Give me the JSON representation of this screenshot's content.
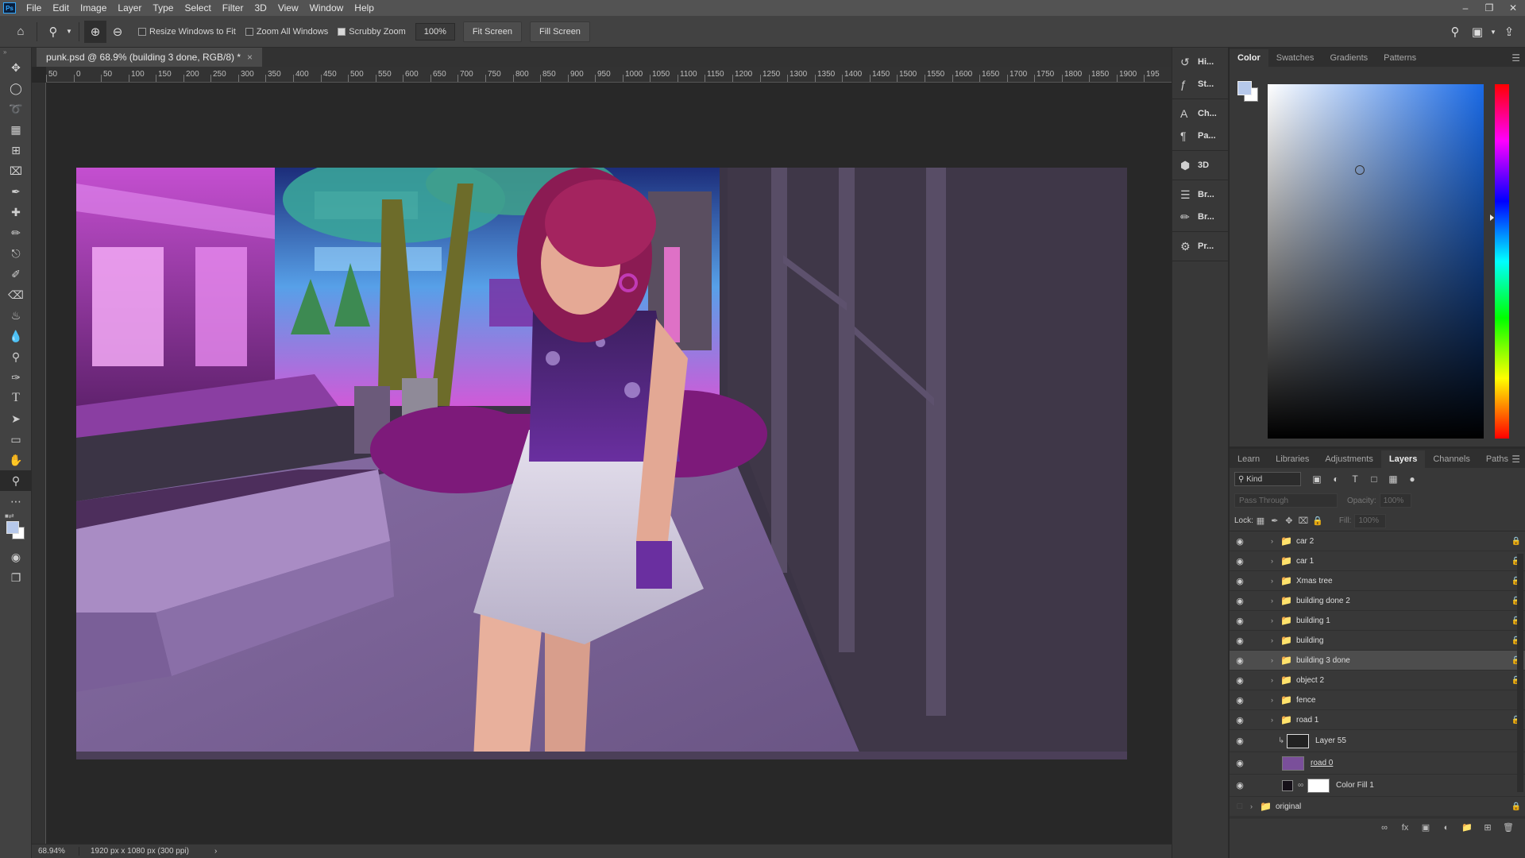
{
  "menu": {
    "items": [
      "File",
      "Edit",
      "Image",
      "Layer",
      "Type",
      "Select",
      "Filter",
      "3D",
      "View",
      "Window",
      "Help"
    ]
  },
  "options": {
    "resize_windows": "Resize Windows to Fit",
    "zoom_all": "Zoom All Windows",
    "scrubby": "Scrubby Zoom",
    "zoom_value": "100%",
    "fit_screen": "Fit Screen",
    "fill_screen": "Fill Screen",
    "resize_checked": false,
    "zoom_all_checked": false,
    "scrubby_checked": true
  },
  "document": {
    "tab_title": "punk.psd @ 68.9% (building 3 done, RGB/8) *"
  },
  "ruler": {
    "top": [
      "50",
      "0",
      "50",
      "100",
      "150",
      "200",
      "250",
      "300",
      "350",
      "400",
      "450",
      "500",
      "550",
      "600",
      "650",
      "700",
      "750",
      "800",
      "850",
      "900",
      "950",
      "1000",
      "1050",
      "1100",
      "1150",
      "1200",
      "1250",
      "1300",
      "1350",
      "1400",
      "1450",
      "1500",
      "1550",
      "1600",
      "1650",
      "1700",
      "1750",
      "1800",
      "1850",
      "1900",
      "195"
    ]
  },
  "status": {
    "zoom": "68.94%",
    "doc_info": "1920 px x 1080 px (300 ppi)"
  },
  "dock": {
    "items": [
      {
        "label": "Hi...",
        "icon": "history-icon"
      },
      {
        "label": "St...",
        "icon": "styles-icon"
      },
      {
        "label": "Ch...",
        "icon": "character-icon"
      },
      {
        "label": "Pa...",
        "icon": "paragraph-icon"
      },
      {
        "label": "3D",
        "icon": "3d-icon"
      },
      {
        "label": "Br...",
        "icon": "brush-settings-icon"
      },
      {
        "label": "Br...",
        "icon": "brushes-icon"
      },
      {
        "label": "Pr...",
        "icon": "properties-icon"
      }
    ]
  },
  "color_panel": {
    "tabs": [
      "Color",
      "Swatches",
      "Gradients",
      "Patterns"
    ],
    "active_tab": "Color",
    "foreground": "#b6c8ea",
    "background": "#ffffff"
  },
  "layers_panel": {
    "tabs": [
      "Learn",
      "Libraries",
      "Adjustments",
      "Layers",
      "Channels",
      "Paths"
    ],
    "active_tab": "Layers",
    "kind": "Kind",
    "blend_mode": "Pass Through",
    "opacity_label": "Opacity:",
    "opacity_value": "100%",
    "lock_label": "Lock:",
    "fill_label": "Fill:",
    "fill_value": "100%",
    "layers": [
      {
        "name": "car 2",
        "type": "group",
        "locked": true,
        "selected": false
      },
      {
        "name": "car 1",
        "type": "group",
        "locked": true,
        "selected": false
      },
      {
        "name": "Xmas tree",
        "type": "group",
        "locked": true,
        "selected": false
      },
      {
        "name": "building done 2",
        "type": "group",
        "locked": true,
        "selected": false
      },
      {
        "name": "building 1",
        "type": "group",
        "locked": true,
        "selected": false
      },
      {
        "name": "building",
        "type": "group",
        "locked": true,
        "selected": false
      },
      {
        "name": "building 3 done",
        "type": "group",
        "locked": true,
        "selected": true
      },
      {
        "name": "object 2",
        "type": "group",
        "locked": true,
        "selected": false
      },
      {
        "name": "fence",
        "type": "group",
        "locked": false,
        "selected": false
      },
      {
        "name": "road 1",
        "type": "group",
        "locked": true,
        "selected": false
      },
      {
        "name": "Layer 55",
        "type": "pixel",
        "locked": false,
        "selected": false
      },
      {
        "name": "road 0",
        "type": "pixel",
        "locked": false,
        "selected": false
      },
      {
        "name": "Color Fill 1",
        "type": "fill",
        "locked": false,
        "selected": false
      },
      {
        "name": "original",
        "type": "group",
        "locked": true,
        "selected": false
      }
    ]
  },
  "colors": {
    "accent": "#31a8ff",
    "panel_bg": "#383838",
    "selected_row": "#4d4d4d"
  }
}
